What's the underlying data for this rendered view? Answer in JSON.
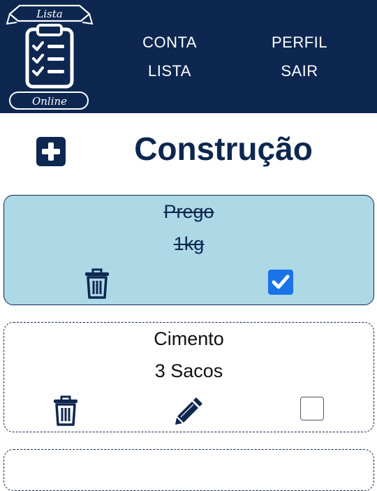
{
  "logo": {
    "top_text": "Lista",
    "bottom_text": "Online",
    "icon": "clipboard-checklist-icon"
  },
  "nav": {
    "conta": "CONTA",
    "lista": "LISTA",
    "perfil": "PERFIL",
    "sair": "SAIR"
  },
  "page": {
    "title": "Construção",
    "add_icon": "plus-square-icon"
  },
  "items": [
    {
      "name": "Prego",
      "quantity": "1kg",
      "checked": true
    },
    {
      "name": "Cimento",
      "quantity": "3 Sacos",
      "checked": false
    }
  ],
  "colors": {
    "primary": "#0d2750",
    "done_card": "#add8e6",
    "checkbox_accent": "#1a73e8"
  }
}
